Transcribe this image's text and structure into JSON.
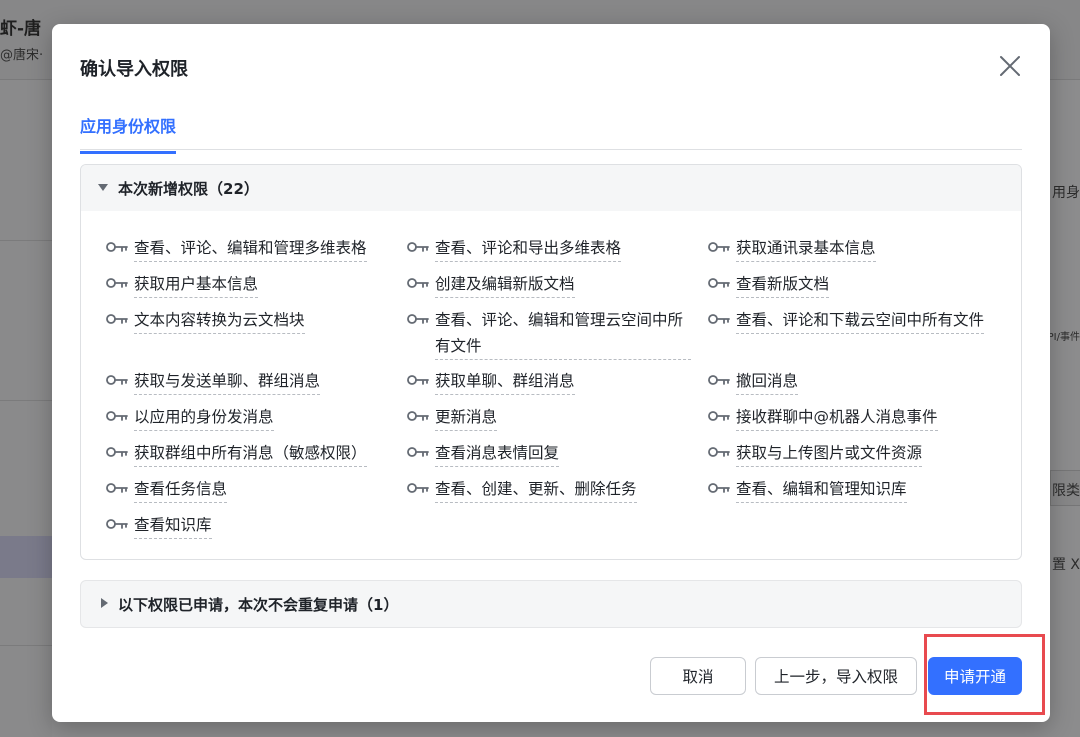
{
  "background": {
    "title": "虾-唐",
    "subtitle": "@唐宋·",
    "right_labels": [
      "用身",
      "PI/事件",
      "限类",
      "置 X"
    ]
  },
  "modal": {
    "title": "确认导入权限",
    "tab": "应用身份权限",
    "section_added": {
      "label": "本次新增权限（22）",
      "permissions": [
        "查看、评论、编辑和管理多维表格",
        "查看、评论和导出多维表格",
        "获取通讯录基本信息",
        "获取用户基本信息",
        "创建及编辑新版文档",
        "查看新版文档",
        "文本内容转换为云文档块",
        "查看、评论、编辑和管理云空间中所有文件",
        "查看、评论和下载云空间中所有文件",
        "获取与发送单聊、群组消息",
        "获取单聊、群组消息",
        "撤回消息",
        "以应用的身份发消息",
        "更新消息",
        "接收群聊中@机器人消息事件",
        "获取群组中所有消息（敏感权限）",
        "查看消息表情回复",
        "获取与上传图片或文件资源",
        "查看任务信息",
        "查看、创建、更新、删除任务",
        "查看、编辑和管理知识库",
        "查看知识库"
      ]
    },
    "section_existing": {
      "label": "以下权限已申请，本次不会重复申请（1）"
    },
    "buttons": {
      "cancel": "取消",
      "back": "上一步，导入权限",
      "apply": "申请开通"
    }
  },
  "colors": {
    "accent": "#3370ff",
    "highlight": "#e84a4f"
  },
  "icons": {
    "permission": "key-icon",
    "close": "close-icon"
  }
}
